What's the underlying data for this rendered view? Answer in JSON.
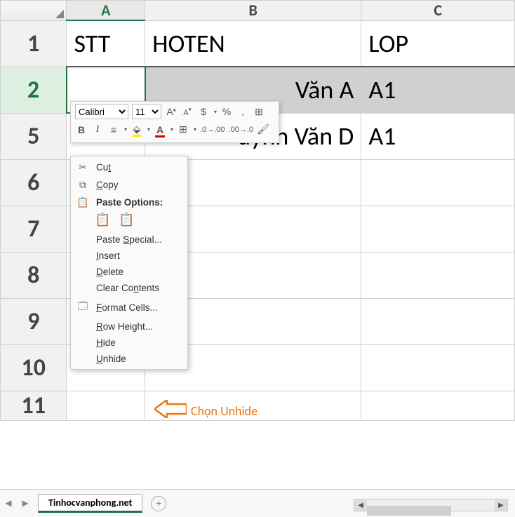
{
  "columns": {
    "A": "A",
    "B": "B",
    "C": "C"
  },
  "rows": [
    "1",
    "2",
    "5",
    "6",
    "7",
    "8",
    "9",
    "10",
    "11"
  ],
  "data": {
    "header": {
      "A": "STT",
      "B": "HOTEN",
      "C": "LOP"
    },
    "row2": {
      "A": "",
      "B_suffix": " Văn A",
      "C": "A1"
    },
    "row5": {
      "A": "",
      "B_suffix": "uỳnh Văn D",
      "C": "A1"
    }
  },
  "mini_toolbar": {
    "font": "Calibri",
    "size": "11",
    "b": "B",
    "i": "I",
    "inc": "A",
    "dec": "A",
    "dollar": "$",
    "percent": "%",
    "comma": ","
  },
  "context_menu": {
    "cut": "Cut",
    "copy": "Copy",
    "paste_options": "Paste Options:",
    "paste_special": "Paste Special...",
    "insert": "Insert",
    "delete": "Delete",
    "clear": "Clear Contents",
    "format": "Format Cells...",
    "rowheight": "Row Height...",
    "hide": "Hide",
    "unhide": "Unhide"
  },
  "annotation": "Chọn Unhide",
  "tab": "Tinhocvanphong.net",
  "addtab": "+"
}
